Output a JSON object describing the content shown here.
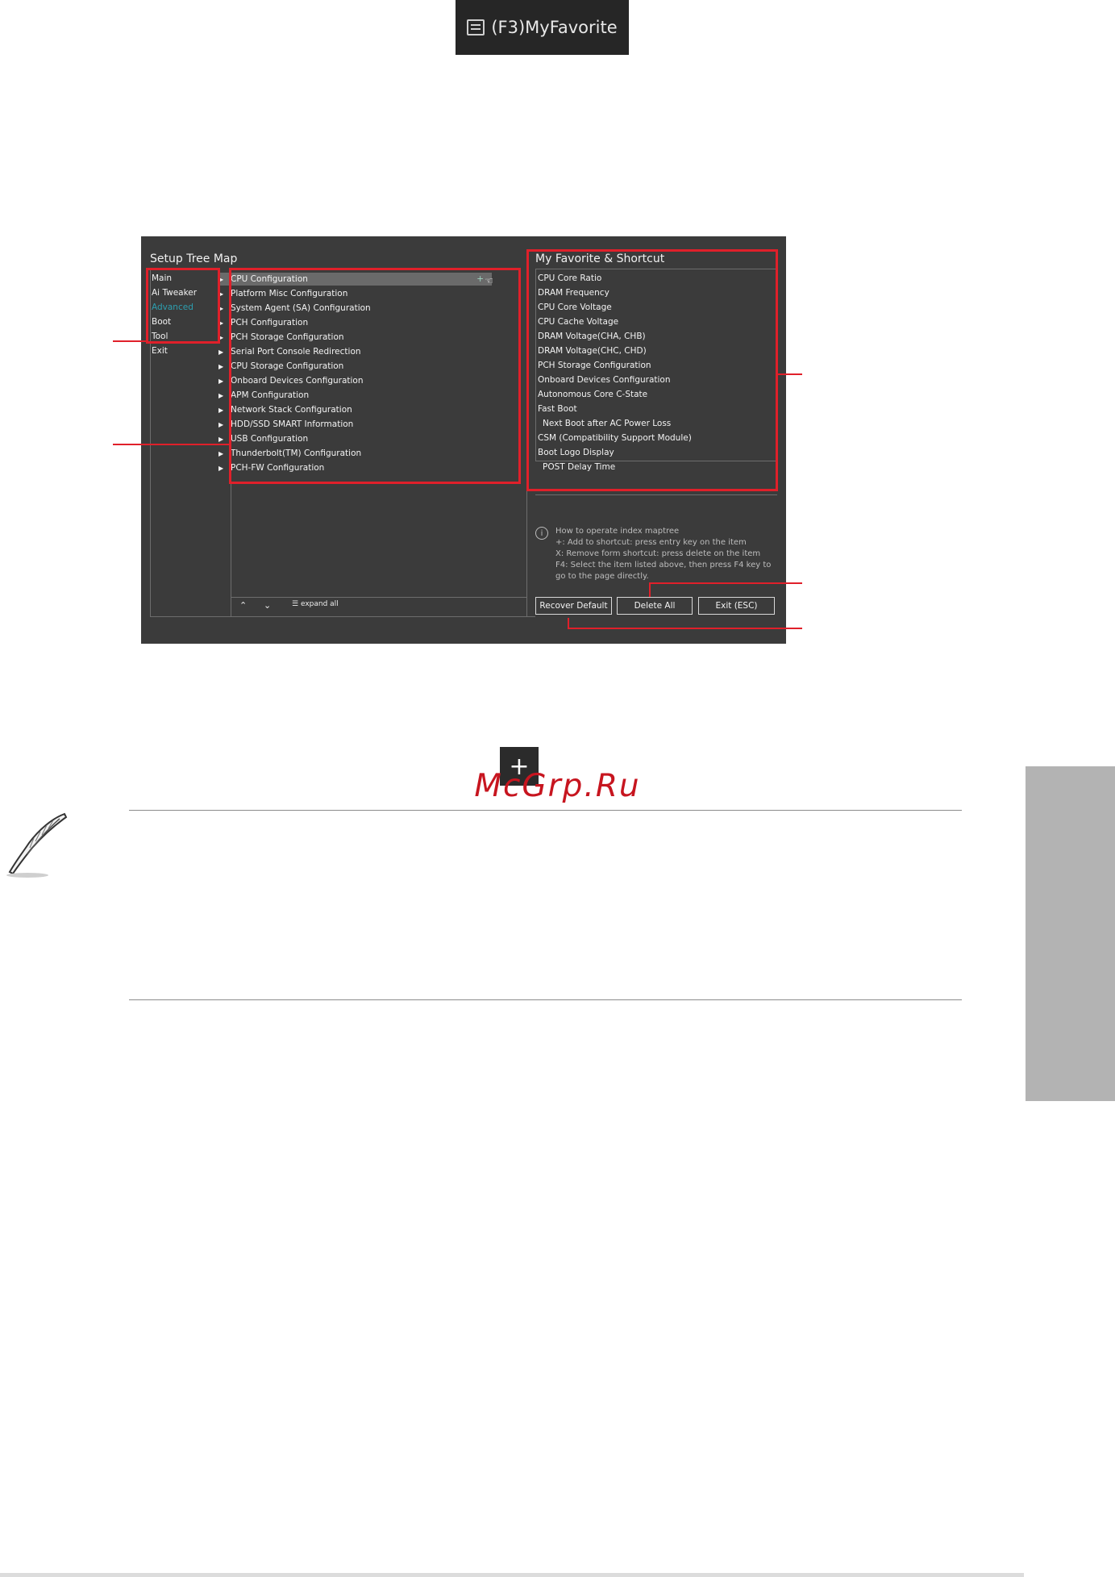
{
  "top_button": {
    "label": "(F3)MyFavorite",
    "icon": "list-icon"
  },
  "tree_map": {
    "title": "Setup Tree Map",
    "menu": [
      "Main",
      "Ai Tweaker",
      "Advanced",
      "Boot",
      "Tool",
      "Exit"
    ],
    "active_menu": "Advanced",
    "submenu": [
      "CPU Configuration",
      "Platform Misc Configuration",
      "System Agent (SA) Configuration",
      "PCH Configuration",
      "PCH Storage Configuration",
      "Serial Port Console Redirection",
      "CPU Storage Configuration",
      "Onboard Devices Configuration",
      "APM Configuration",
      "Network Stack Configuration",
      "HDD/SSD SMART Information",
      "USB Configuration",
      "Thunderbolt(TM) Configuration",
      "PCH-FW Configuration"
    ],
    "expand_all": "expand all"
  },
  "favorites": {
    "title": "My Favorite & Shortcut",
    "items": [
      "CPU Core Ratio",
      "DRAM Frequency",
      "CPU Core Voltage",
      "CPU Cache Voltage",
      "DRAM Voltage(CHA, CHB)",
      "DRAM Voltage(CHC, CHD)",
      "PCH Storage Configuration",
      "Onboard Devices Configuration",
      "Autonomous Core C-State",
      "Fast Boot",
      "Next Boot after AC Power Loss",
      "CSM (Compatibility Support Module)",
      "Boot Logo Display",
      "POST Delay Time"
    ],
    "indented": [
      "Next Boot after AC Power Loss",
      "POST Delay Time"
    ]
  },
  "help": {
    "lines": [
      "How to operate index maptree",
      "+: Add to shortcut: press entry key on the item",
      "X: Remove form shortcut: press delete on the item",
      "F4: Select the item listed above, then press F4 key to",
      "go to the page directly."
    ]
  },
  "buttons": {
    "recover": "Recover Default",
    "delete_all": "Delete All",
    "exit": "Exit (ESC)"
  },
  "plus_icon_label": "+",
  "watermark": "McGrp.Ru",
  "colors": {
    "accent_red": "#e0202a",
    "active_teal": "#2d9fb0",
    "bios_bg": "#3b3b3b"
  }
}
